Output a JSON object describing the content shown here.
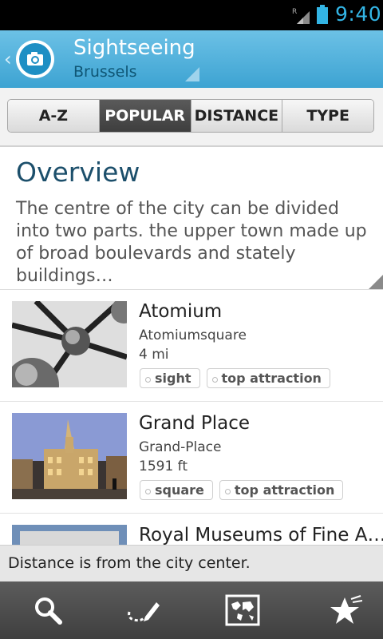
{
  "status_bar": {
    "time": "9:40",
    "network_letter": "R"
  },
  "header": {
    "title": "Sightseeing",
    "subtitle": "Brussels",
    "accent": "#3da3d2"
  },
  "tabs": [
    {
      "label": "A-Z",
      "active": false
    },
    {
      "label": "POPULAR",
      "active": true
    },
    {
      "label": "DISTANCE",
      "active": false
    },
    {
      "label": "TYPE",
      "active": false
    }
  ],
  "overview": {
    "heading": "Overview",
    "text": "The centre of the city can be divided into two parts. the upper town made up of broad boulevards and stately buildings…"
  },
  "places": [
    {
      "name": "Atomium",
      "address": "Atomiumsquare",
      "distance": "4 mi",
      "tags": [
        "sight",
        "top attraction"
      ]
    },
    {
      "name": "Grand Place",
      "address": "Grand-Place",
      "distance": "1591 ft",
      "tags": [
        "square",
        "top attraction"
      ]
    },
    {
      "name": "Royal Museums of Fine A…"
    }
  ],
  "toast": "Distance is from the city center.",
  "bottom_nav": [
    "search-icon",
    "route-edit-icon",
    "world-map-icon",
    "favorites-star-icon"
  ]
}
